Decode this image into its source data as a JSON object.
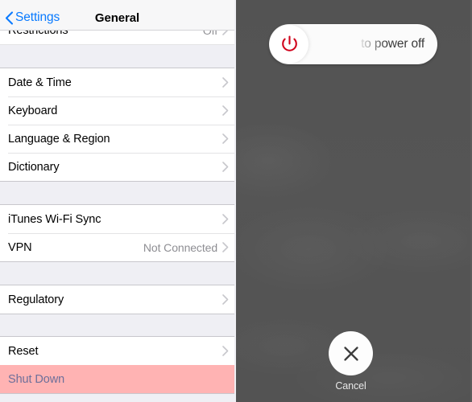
{
  "status_bar": {
    "visible": false
  },
  "nav_bar": {
    "back_label": "Settings",
    "back_icon": "chevron-left-icon",
    "title": "General"
  },
  "settings": {
    "partial_row": {
      "label": "Restrictions",
      "value": "Off",
      "accessory": "chevron-right-icon"
    },
    "groups": [
      {
        "rows": [
          {
            "label": "Date & Time",
            "value": "",
            "accessory": "chevron-right-icon",
            "style": "default"
          },
          {
            "label": "Keyboard",
            "value": "",
            "accessory": "chevron-right-icon",
            "style": "default"
          },
          {
            "label": "Language & Region",
            "value": "",
            "accessory": "chevron-right-icon",
            "style": "default"
          },
          {
            "label": "Dictionary",
            "value": "",
            "accessory": "chevron-right-icon",
            "style": "default"
          }
        ]
      },
      {
        "rows": [
          {
            "label": "iTunes Wi-Fi Sync",
            "value": "",
            "accessory": "chevron-right-icon",
            "style": "default"
          },
          {
            "label": "VPN",
            "value": "Not Connected",
            "accessory": "chevron-right-icon",
            "style": "default"
          }
        ]
      },
      {
        "rows": [
          {
            "label": "Regulatory",
            "value": "",
            "accessory": "chevron-right-icon",
            "style": "default"
          }
        ]
      },
      {
        "rows": [
          {
            "label": "Reset",
            "value": "",
            "accessory": "chevron-right-icon",
            "style": "default"
          },
          {
            "label": "Shut Down",
            "value": "",
            "accessory": "",
            "style": "danger-highlighted"
          }
        ]
      }
    ]
  },
  "power_overlay": {
    "slider": {
      "text": "to power off",
      "full_text": "slide to power off",
      "knob_icon": "power-icon",
      "knob_icon_color": "#d0021b"
    },
    "cancel": {
      "label": "Cancel",
      "icon": "close-x-icon"
    }
  },
  "colors": {
    "accent_blue": "#097aff",
    "danger_row_background": "#ffb3b3",
    "danger_row_text": "#6d6f9a",
    "power_red": "#d0021b",
    "overlay_backdrop": "#545454",
    "list_background": "#efeff4",
    "row_background": "#ffffff"
  }
}
